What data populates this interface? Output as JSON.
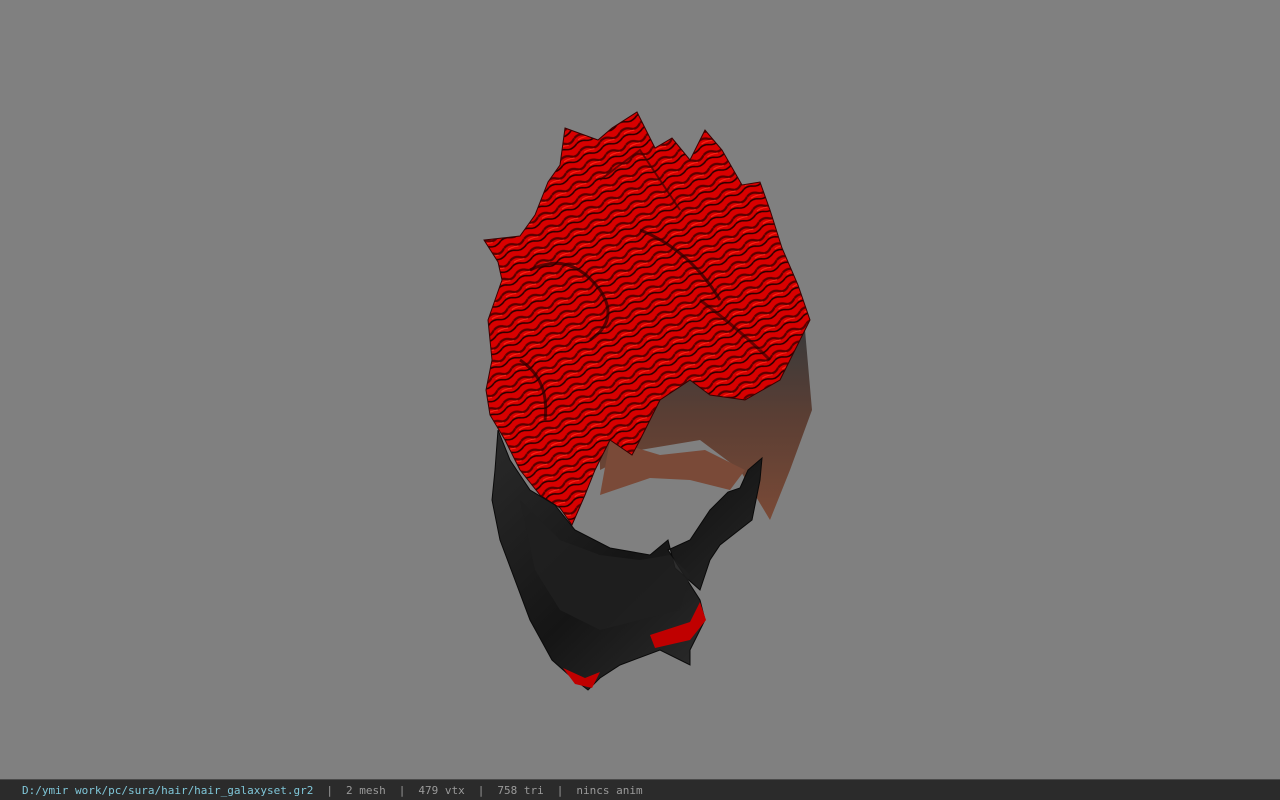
{
  "viewport": {
    "background_color": "#808080",
    "model": {
      "subject": "hair-mesh-icon",
      "hair_color": "#d10000",
      "mask_color": "#1a1a1a",
      "skin_color": "#6b4434"
    }
  },
  "status_bar": {
    "file_path": "D:/ymir work/pc/sura/hair/hair_galaxyset.gr2",
    "separator": "|",
    "mesh_count": "2 mesh",
    "vertex_count": "479 vtx",
    "triangle_count": "758 tri",
    "animation": "nincs anim",
    "path_color": "#7fc6d8",
    "text_color": "#9a9a9a"
  }
}
